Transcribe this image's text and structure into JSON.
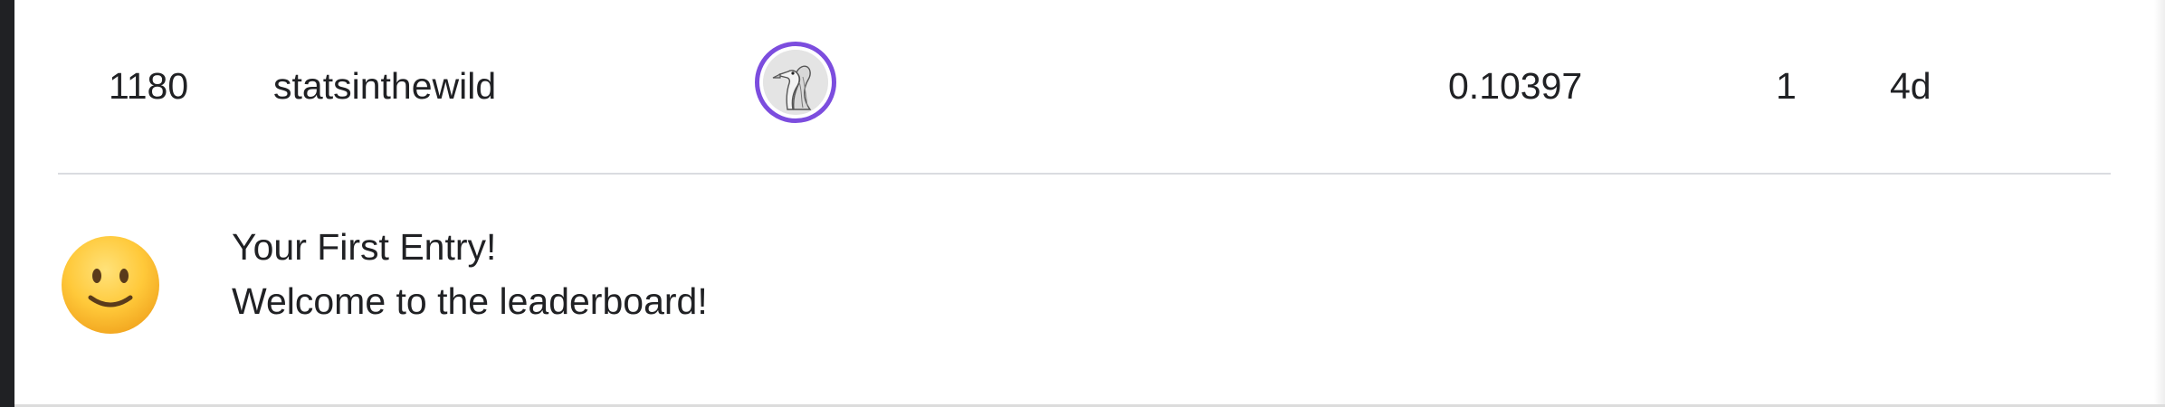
{
  "leaderboard_row": {
    "rank": "1180",
    "team_name": "statsinthewild",
    "avatar_icon": "goose-avatar-icon",
    "score": "0.10397",
    "entries": "1",
    "last_submission": "4d"
  },
  "banner": {
    "emoji_icon": "slightly-smiling-face-icon",
    "title": "Your First Entry!",
    "message": "Welcome to the leaderboard!"
  },
  "colors": {
    "avatar_ring": "#7c4dde",
    "text": "#202124",
    "divider": "#dadce0",
    "left_rail": "#202124"
  }
}
